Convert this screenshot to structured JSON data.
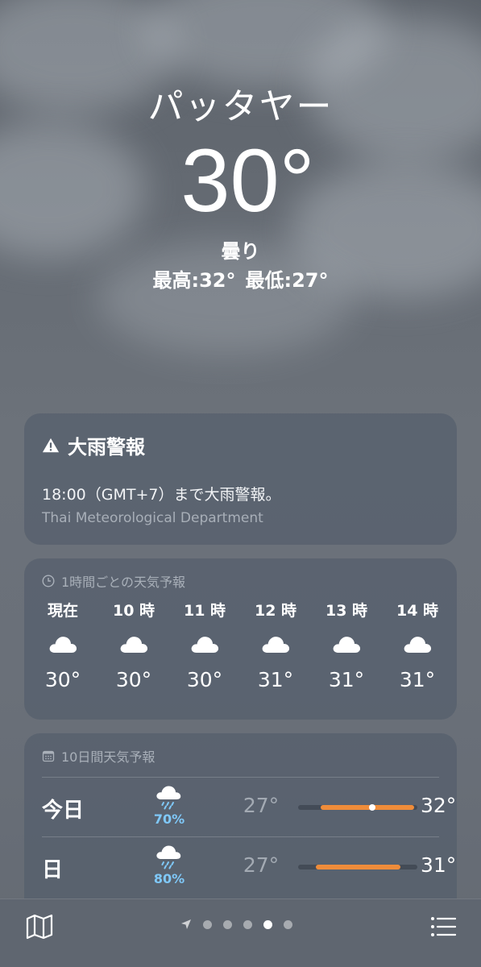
{
  "location": {
    "city": "パッタヤー",
    "temperature": "30°",
    "condition": "曇り",
    "high": "最高:32°",
    "low": "最低:27°"
  },
  "alert": {
    "title": "大雨警報",
    "text": "18:00（GMT+7）まで大雨警報。",
    "source": "Thai Meteorological Department",
    "icon": "warning-icon"
  },
  "hourly": {
    "header": "1時間ごとの天気予報",
    "icon": "clock-icon",
    "items": [
      {
        "label": "現在",
        "icon": "cloud-icon",
        "temp": "30°"
      },
      {
        "label": "10 時",
        "icon": "cloud-icon",
        "temp": "30°"
      },
      {
        "label": "11 時",
        "icon": "cloud-icon",
        "temp": "30°"
      },
      {
        "label": "12 時",
        "icon": "cloud-icon",
        "temp": "31°"
      },
      {
        "label": "13 時",
        "icon": "cloud-icon",
        "temp": "31°"
      },
      {
        "label": "14 時",
        "icon": "cloud-icon",
        "temp": "31°"
      }
    ]
  },
  "daily": {
    "header": "10日間天気予報",
    "icon": "calendar-icon",
    "days": [
      {
        "name": "今日",
        "icon": "cloud-rain-icon",
        "pop": "70%",
        "low": "27°",
        "high": "32°",
        "range_start": 0.19,
        "range_end": 0.97,
        "current": 0.62
      },
      {
        "name": "日",
        "icon": "cloud-rain-icon",
        "pop": "80%",
        "low": "27°",
        "high": "31°",
        "range_start": 0.15,
        "range_end": 0.86
      }
    ]
  },
  "toolbar": {
    "map_icon": "map-icon",
    "location_icon": "location-arrow-icon",
    "list_icon": "list-icon",
    "page_count": 5,
    "active_page": 3
  },
  "colors": {
    "accent_orange": "#ef8c3a",
    "precip_blue": "#7fc8f8",
    "card_bg": "#545e6c"
  }
}
